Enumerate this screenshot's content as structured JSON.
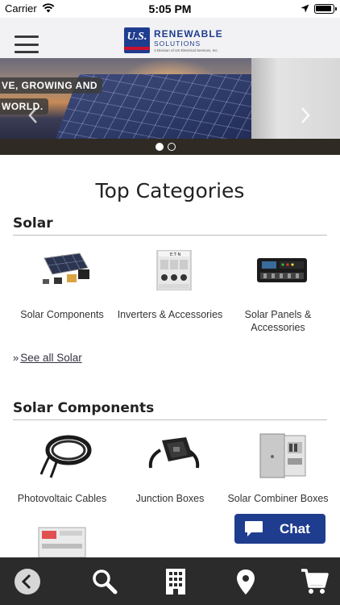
{
  "status_bar": {
    "carrier": "Carrier",
    "time": "5:05 PM"
  },
  "header": {
    "logo_badge": "U.S.",
    "logo_title": "RENEWABLE",
    "logo_subtitle": "SOLUTIONS",
    "logo_tagline": "A Division of US Electrical Services, Inc."
  },
  "banner": {
    "caption_line1": "VE, GROWING AND",
    "caption_line2": "WORLD.",
    "active_slide": 1,
    "slide_count": 2
  },
  "main": {
    "title": "Top Categories",
    "sections": [
      {
        "title": "Solar",
        "items": [
          {
            "label": "Solar Components",
            "icon": "solar-kit-image"
          },
          {
            "label": "Inverters & Accessories",
            "icon": "inverter-image"
          },
          {
            "label": "Solar Panels & Accessories",
            "icon": "charge-controller-image"
          }
        ],
        "see_all": "See all Solar"
      },
      {
        "title": "Solar Components",
        "items": [
          {
            "label": "Photovoltaic Cables",
            "icon": "cable-coil-image"
          },
          {
            "label": "Junction Boxes",
            "icon": "junction-box-image"
          },
          {
            "label": "Solar Combiner Boxes",
            "icon": "combiner-box-image"
          }
        ]
      }
    ]
  },
  "chat": {
    "label": "Chat"
  },
  "bottom_nav": [
    "back-icon",
    "search-icon",
    "building-icon",
    "location-pin-icon",
    "cart-icon"
  ],
  "colors": {
    "brand_blue": "#1f3d8f",
    "brand_red": "#c8102e",
    "bottom_bar": "#2b2b2b"
  }
}
